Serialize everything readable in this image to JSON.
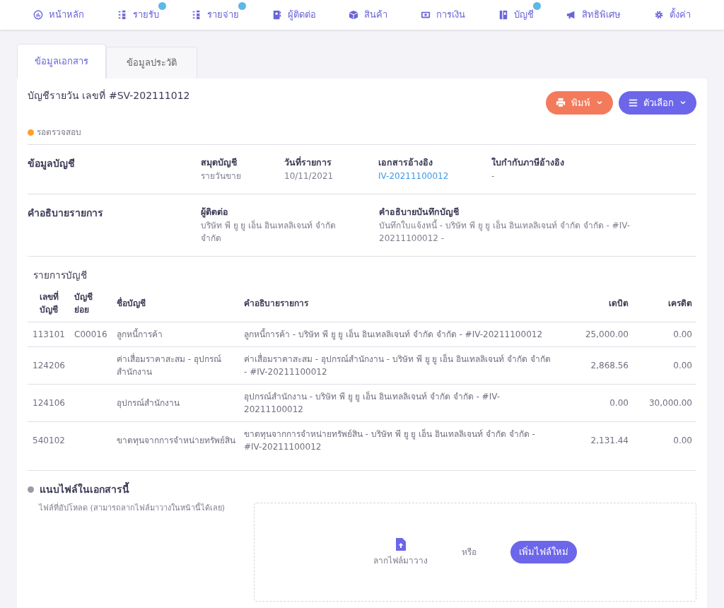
{
  "nav": [
    {
      "label": "หน้าหลัก",
      "notification": false
    },
    {
      "label": "รายรับ",
      "notification": true
    },
    {
      "label": "รายจ่าย",
      "notification": true
    },
    {
      "label": "ผู้ติดต่อ",
      "notification": false
    },
    {
      "label": "สินค้า",
      "notification": false
    },
    {
      "label": "การเงิน",
      "notification": false
    },
    {
      "label": "บัญชี",
      "notification": true
    },
    {
      "label": "สิทธิพิเศษ",
      "notification": false
    },
    {
      "label": "ตั้งค่า",
      "notification": false
    }
  ],
  "tabs": [
    {
      "label": "ข้อมูลเอกสาร",
      "selected": true
    },
    {
      "label": "ข้อมูลประวัติ",
      "selected": false
    }
  ],
  "document": {
    "title": "บัญชีรายวัน เลขที่ #SV-202111012",
    "status": {
      "label": "รอตรวจสอบ",
      "color": "#ff9f2e"
    },
    "buttons": [
      {
        "kind": "print",
        "label": "พิมพ์"
      },
      {
        "kind": "options",
        "label": "ตัวเลือก"
      }
    ]
  },
  "account_info": {
    "heading": "ข้อมูลบัญชี",
    "fields": [
      {
        "label": "สมุดบัญชี",
        "value": "รายวันขาย",
        "link": false
      },
      {
        "label": "วันที่รายการ",
        "value": "10/11/2021",
        "link": false
      },
      {
        "label": "เอกสารอ้างอิง",
        "value": "IV-20211100012",
        "link": true
      },
      {
        "label": "ใบกำกับภาษีอ้างอิง",
        "value": "-",
        "link": false
      }
    ]
  },
  "description": {
    "heading": "คำอธิบายรายการ",
    "fields": [
      {
        "label": "ผู้ติดต่อ",
        "value": "บริษัท พี ยู ยู เอ็น อินเทลลิเจนท์ จำกัด จำกัด"
      },
      {
        "label": "คำอธิบายบันทึกบัญชี",
        "value": "บันทึกใบแจ้งหนี้ - บริษัท พี ยู ยู เอ็น อินเทลลิเจนท์ จำกัด จำกัด - #IV-20211100012 -"
      }
    ]
  },
  "entries": {
    "heading": "รายการบัญชี",
    "columns": [
      "เลขที่ บัญชี",
      "บัญชี ย่อย",
      "ชื่อบัญชี",
      "คำอธิบายรายการ",
      "เดบิต",
      "เครดิต"
    ],
    "rows": [
      [
        "113101",
        "C00016",
        "ลูกหนี้การค้า",
        "ลูกหนี้การค้า - บริษัท พี ยู ยู เอ็น อินเทลลิเจนท์ จำกัด จำกัด - #IV-20211100012",
        "25,000.00",
        "0.00"
      ],
      [
        "124206",
        "",
        "ค่าเสื่อมราคาสะสม - อุปกรณ์สำนักงาน",
        "ค่าเสื่อมราคาสะสม - อุปกรณ์สำนักงาน - บริษัท พี ยู ยู เอ็น อินเทลลิเจนท์ จำกัด จำกัด - #IV-20211100012",
        "2,868.56",
        "0.00"
      ],
      [
        "124106",
        "",
        "อุปกรณ์สำนักงาน",
        "อุปกรณ์สำนักงาน - บริษัท พี ยู ยู เอ็น อินเทลลิเจนท์ จำกัด จำกัด - #IV-20211100012",
        "0.00",
        "30,000.00"
      ],
      [
        "540102",
        "",
        "ขาดทุนจากการจำหน่ายทรัพย์สิน",
        "ขาดทุนจากการจำหน่ายทรัพย์สิน - บริษัท พี ยู ยู เอ็น อินเทลลิเจนท์ จำกัด จำกัด - #IV-20211100012",
        "2,131.44",
        "0.00"
      ]
    ]
  },
  "attachments": {
    "heading": "แนบไฟล์ในเอกสารนี้",
    "hint": "ไฟล์ที่อัปโหลด (สามารถลากไฟล์มาวางในหน้านี้ได้เลย)",
    "drop_label": "ลากไฟล์มาวาง",
    "or": "หรือ",
    "add_button": "เพิ่มไฟล์ใหม่"
  }
}
